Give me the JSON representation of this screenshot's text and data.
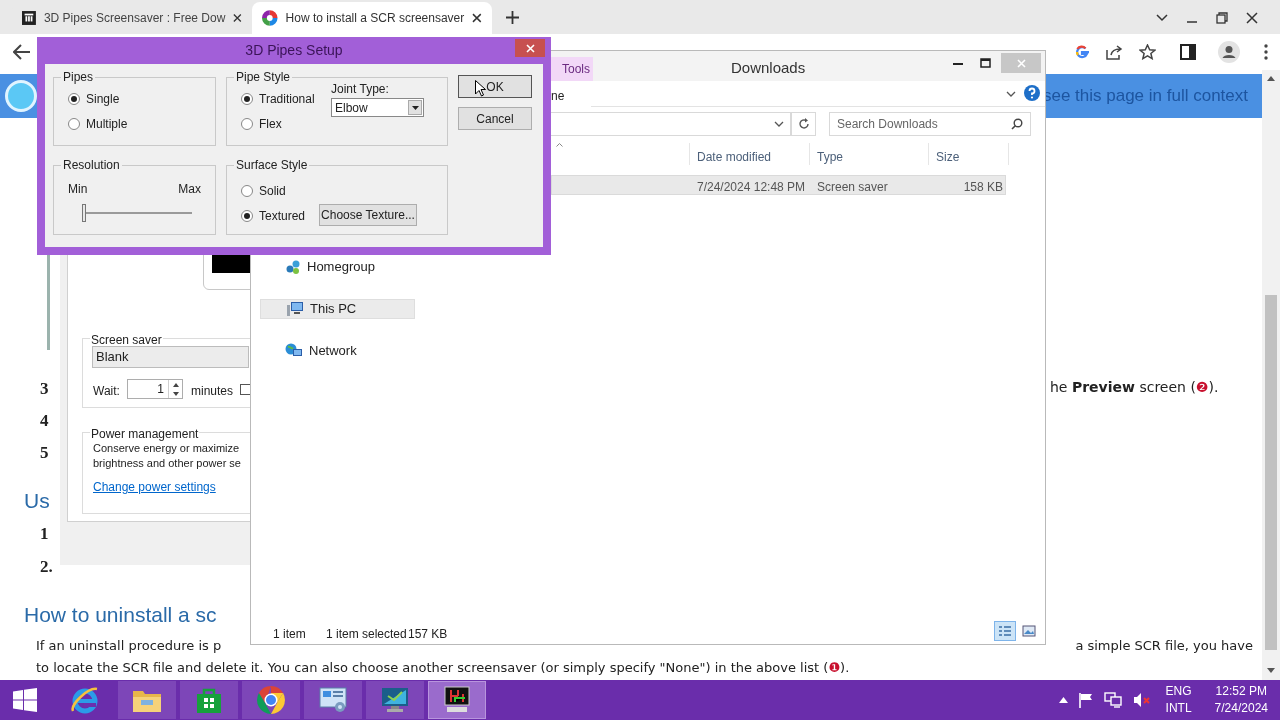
{
  "browser": {
    "tabs": [
      {
        "title": "3D Pipes Screensaver : Free Dow",
        "kind": "archive",
        "selected": false
      },
      {
        "title": "How to install a SCR screensaver",
        "kind": "site",
        "selected": true
      }
    ]
  },
  "page": {
    "banner_link": "see this page in full context",
    "preview_line": {
      "before": "he **Preview** screen (",
      "marker": "❷",
      "after": ")."
    },
    "step_numbers": [
      "3",
      "4",
      "5"
    ],
    "section_heading": "Us",
    "steps_below": [
      "1",
      "2."
    ],
    "uninstall_heading": "How to uninstall a sc",
    "uninstall_line_start": "If an uninstall procedure is p",
    "uninstall_line_end": "a simple SCR file, you have",
    "uninstall_line_2": {
      "before": "to locate the SCR file and delete it. You can also choose another screensaver (or simply specify \"None\") in the above list (",
      "marker": "❶",
      "after": ")."
    }
  },
  "control_panel": {
    "screen_saver_label": "Screen saver",
    "screen_saver_value": "Blank",
    "wait_label": "Wait:",
    "wait_value": "1",
    "wait_unit": "minutes",
    "resume_checked": false,
    "power_label": "Power management",
    "power_text": [
      "Conserve energy or maximize",
      "brightness and other power se"
    ],
    "power_link": "Change power settings"
  },
  "explorer": {
    "title": "Downloads",
    "ribbon_tab": "Tools",
    "ribbon_text": "ne",
    "search_placeholder": "Search Downloads",
    "columns": [
      "Date modified",
      "Type",
      "Size"
    ],
    "rows": [
      {
        "date": "7/24/2024 12:48 PM",
        "type": "Screen saver",
        "size": "158 KB",
        "selected": true
      }
    ],
    "nav": [
      {
        "label": "Homegroup",
        "kind": "homegroup",
        "selected": false
      },
      {
        "label": "This PC",
        "kind": "pc",
        "selected": true
      },
      {
        "label": "Network",
        "kind": "network",
        "selected": false
      }
    ],
    "status": {
      "count": "1 item",
      "selection": "1 item selected",
      "selection_size": "157 KB"
    },
    "views": [
      {
        "kind": "details",
        "selected": true
      },
      {
        "kind": "tiles",
        "selected": false
      }
    ]
  },
  "setup_dialog": {
    "title": "3D Pipes Setup",
    "pipes": {
      "label": "Pipes",
      "options": [
        {
          "label": "Single",
          "selected": true
        },
        {
          "label": "Multiple",
          "selected": false
        }
      ]
    },
    "pipe_style": {
      "label": "Pipe Style",
      "options": [
        {
          "label": "Traditional",
          "selected": true
        },
        {
          "label": "Flex",
          "selected": false
        }
      ],
      "joint_label": "Joint Type:",
      "joint_value": "Elbow"
    },
    "resolution": {
      "label": "Resolution",
      "min": "Min",
      "max": "Max",
      "level": 0
    },
    "surface": {
      "label": "Surface Style",
      "options": [
        {
          "label": "Solid",
          "selected": false
        },
        {
          "label": "Textured",
          "selected": true
        }
      ],
      "texture_button": "Choose Texture..."
    },
    "buttons": [
      "OK",
      "Cancel"
    ]
  },
  "taskbar": {
    "apps": [
      {
        "kind": "ie",
        "selected": false
      },
      {
        "kind": "folder",
        "selected": false
      },
      {
        "kind": "store",
        "selected": false
      },
      {
        "kind": "chrome",
        "selected": false
      },
      {
        "kind": "control-panel",
        "selected": false
      },
      {
        "kind": "monitor",
        "selected": false
      },
      {
        "kind": "screensaver",
        "selected": true
      }
    ],
    "tray": {
      "language": "ENG",
      "layout": "INTL",
      "time": "12:52 PM",
      "date": "7/24/2024"
    }
  }
}
